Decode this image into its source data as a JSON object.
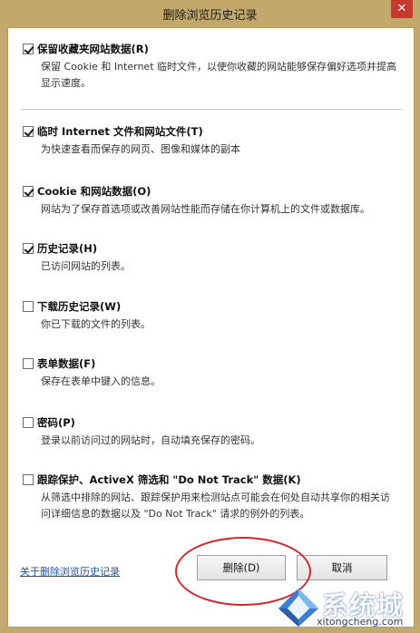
{
  "window": {
    "title": "删除浏览历史记录",
    "close_glyph": "✕"
  },
  "options": [
    {
      "label": "保留收藏夹网站数据(R)",
      "checked": true,
      "description": "保留 Cookie 和 Internet 临时文件，以使你收藏的网站能够保存偏好选项并提高显示速度。"
    },
    {
      "label": "临时 Internet 文件和网站文件(T)",
      "checked": true,
      "description": "为快速查看而保存的网页、图像和媒体的副本"
    },
    {
      "label": "Cookie 和网站数据(O)",
      "checked": true,
      "description": "网站为了保存首选项或改善网站性能而存储在你计算机上的文件或数据库。"
    },
    {
      "label": "历史记录(H)",
      "checked": true,
      "description": "已访问网站的列表。"
    },
    {
      "label": "下载历史记录(W)",
      "checked": false,
      "description": "你已下载的文件的列表。"
    },
    {
      "label": "表单数据(F)",
      "checked": false,
      "description": "保存在表单中键入的信息。"
    },
    {
      "label": "密码(P)",
      "checked": false,
      "description": "登录以前访问过的网站时，自动填充保存的密码。"
    },
    {
      "label": "跟踪保护、ActiveX 筛选和 \"Do Not Track\" 数据(K)",
      "checked": false,
      "description": "从筛选中排除的网站、跟踪保护用来检测站点可能会在何处自动共享你的相关访问详细信息的数据以及 \"Do Not Track\" 请求的例外的列表。"
    }
  ],
  "footer": {
    "about_link": "关于删除浏览历史记录",
    "delete_button": "删除(D)",
    "cancel_button": "取消"
  },
  "watermark": {
    "brand": "系统城",
    "url": "xitongcheng.com"
  },
  "colors": {
    "title_bar": "#c2a86b",
    "close_button": "#c7392f",
    "link": "#1a55b4",
    "annotation": "#d7262a"
  }
}
